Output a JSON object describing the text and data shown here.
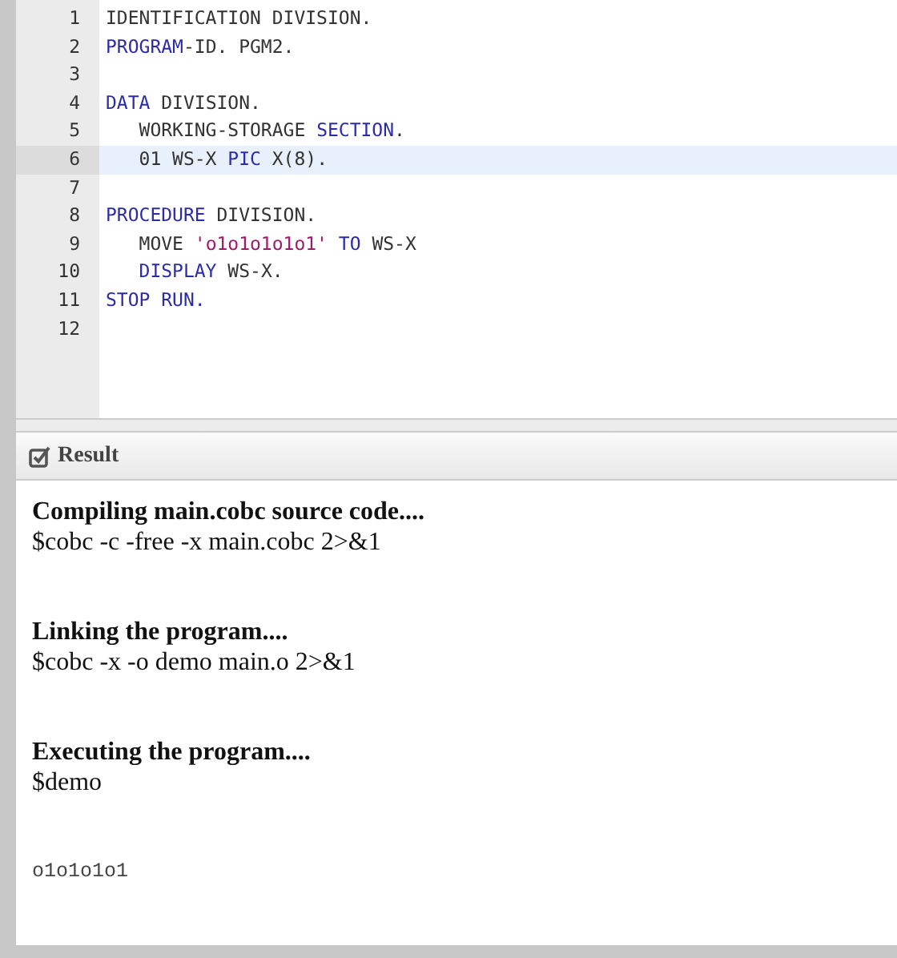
{
  "editor": {
    "lines": [
      {
        "number": "1",
        "active": false,
        "tokens": [
          {
            "kind": "text",
            "text": "IDENTIFICATION DIVISION."
          }
        ]
      },
      {
        "number": "2",
        "active": false,
        "tokens": [
          {
            "kind": "keyword",
            "text": "PROGRAM"
          },
          {
            "kind": "text",
            "text": "-ID. PGM2."
          }
        ]
      },
      {
        "number": "3",
        "active": false
      },
      {
        "number": "4",
        "active": false,
        "tokens": [
          {
            "kind": "keyword",
            "text": "DATA"
          },
          {
            "kind": "text",
            "text": " DIVISION."
          }
        ]
      },
      {
        "number": "5",
        "active": false,
        "tokens": [
          {
            "kind": "text",
            "text": "   WORKING-STORAGE "
          },
          {
            "kind": "keyword",
            "text": "SECTION"
          },
          {
            "kind": "text",
            "text": "."
          }
        ]
      },
      {
        "number": "6",
        "active": true,
        "tokens": [
          {
            "kind": "text",
            "text": "   01 WS-X "
          },
          {
            "kind": "keyword",
            "text": "PIC"
          },
          {
            "kind": "text",
            "text": " X(8)."
          }
        ]
      },
      {
        "number": "7",
        "active": false
      },
      {
        "number": "8",
        "active": false,
        "tokens": [
          {
            "kind": "keyword",
            "text": "PROCEDURE"
          },
          {
            "kind": "text",
            "text": " DIVISION."
          }
        ]
      },
      {
        "number": "9",
        "active": false,
        "tokens": [
          {
            "kind": "text",
            "text": "   MOVE "
          },
          {
            "kind": "string",
            "text": "'o1o1o1o1o1'"
          },
          {
            "kind": "keyword",
            "text": " TO"
          },
          {
            "kind": "text",
            "text": " WS-X"
          }
        ]
      },
      {
        "number": "10",
        "active": false,
        "tokens": [
          {
            "kind": "keyword",
            "text": "   DISPLAY"
          },
          {
            "kind": "text",
            "text": " WS-X."
          }
        ]
      },
      {
        "number": "11",
        "active": false,
        "tokens": [
          {
            "kind": "keyword",
            "text": "STOP RUN."
          }
        ]
      },
      {
        "number": "12",
        "active": false
      }
    ]
  },
  "result": {
    "title": "Result",
    "blocks": [
      {
        "kind": "step",
        "heading": "Compiling main.cobc source code....",
        "command": "$cobc -c -free -x main.cobc 2>&1"
      },
      {
        "kind": "step",
        "heading": "Linking the program....",
        "command": "$cobc -x -o demo main.o 2>&1"
      },
      {
        "kind": "step",
        "heading": "Executing the program....",
        "command": "$demo"
      },
      {
        "kind": "output",
        "text": "o1o1o1o1"
      }
    ]
  }
}
